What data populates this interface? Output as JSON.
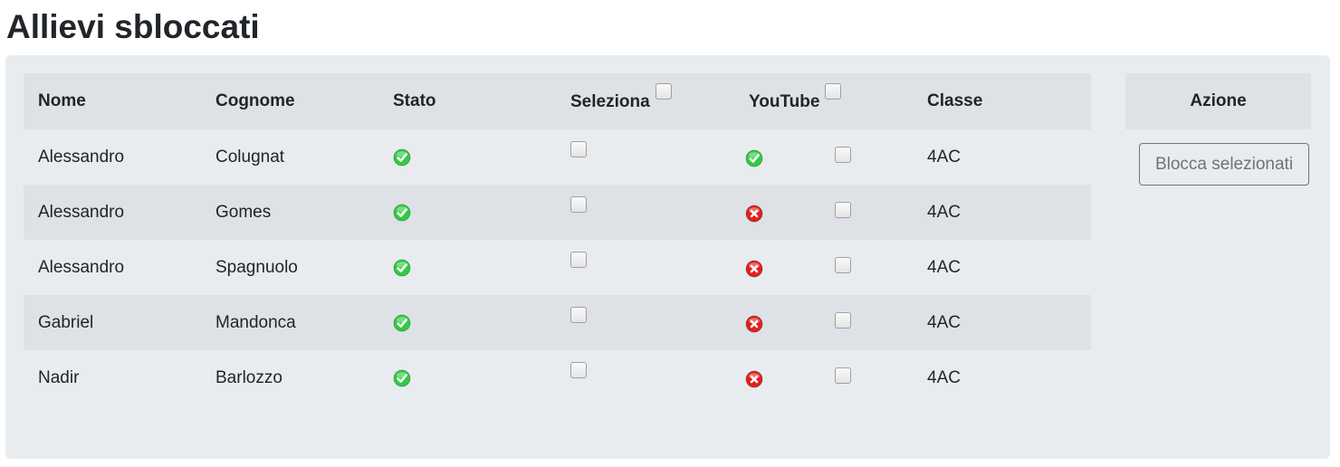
{
  "page": {
    "title": "Allievi sbloccati"
  },
  "table": {
    "headers": {
      "nome": "Nome",
      "cognome": "Cognome",
      "stato": "Stato",
      "seleziona": "Seleziona",
      "youtube": "YouTube",
      "classe": "Classe"
    },
    "rows": [
      {
        "nome": "Alessandro",
        "cognome": "Colugnat",
        "stato": "sbloccato",
        "selected": false,
        "youtube": "sbloccato",
        "youtube_selected": false,
        "classe": "4AC"
      },
      {
        "nome": "Alessandro",
        "cognome": "Gomes",
        "stato": "sbloccato",
        "selected": false,
        "youtube": "bloccato",
        "youtube_selected": false,
        "classe": "4AC"
      },
      {
        "nome": "Alessandro",
        "cognome": "Spagnuolo",
        "stato": "sbloccato",
        "selected": false,
        "youtube": "bloccato",
        "youtube_selected": false,
        "classe": "4AC"
      },
      {
        "nome": "Gabriel",
        "cognome": "Mandonca",
        "stato": "sbloccato",
        "selected": false,
        "youtube": "bloccato",
        "youtube_selected": false,
        "classe": "4AC"
      },
      {
        "nome": "Nadir",
        "cognome": "Barlozzo",
        "stato": "sbloccato",
        "selected": false,
        "youtube": "bloccato",
        "youtube_selected": false,
        "classe": "4AC"
      }
    ]
  },
  "action": {
    "header": "Azione",
    "button_label": "Blocca selezionati"
  },
  "icons": {
    "ok": "check-circle-icon",
    "blocked": "x-circle-icon"
  },
  "colors": {
    "ok": "#2ecc40",
    "blocked": "#e0201c",
    "panel": "#e9ecef",
    "header_bg": "#dee2e6"
  }
}
